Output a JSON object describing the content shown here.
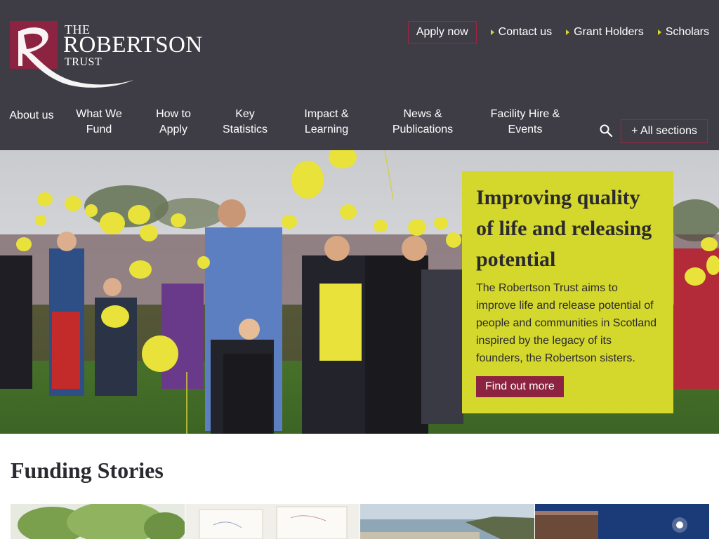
{
  "logo": {
    "line1": "THE",
    "line2": "ROBERTSON",
    "line3": "TRUST",
    "color": "#8c2340"
  },
  "utility_nav": {
    "apply_label": "Apply now",
    "links": [
      {
        "label": "Contact us",
        "icon": "triangle-right-icon"
      },
      {
        "label": "Grant Holders",
        "icon": "triangle-right-icon"
      },
      {
        "label": "Scholars",
        "icon": "triangle-right-icon"
      }
    ]
  },
  "main_nav": {
    "items": [
      {
        "label": "About us"
      },
      {
        "label": "What We Fund"
      },
      {
        "label": "How to Apply"
      },
      {
        "label": "Key Statistics"
      },
      {
        "label": "Impact & Learning"
      },
      {
        "label": "News & Publications"
      },
      {
        "label": "Facility Hire & Events"
      }
    ],
    "search_icon": "search-icon",
    "all_sections_label": "+ All sections"
  },
  "hero": {
    "heading": "Improving quality of life and releasing potential",
    "text": "The Robertson Trust aims to improve life and release potential of people and communities in Scotland inspired by the legacy of its founders, the Robertson sisters.",
    "cta_label": "Find out more"
  },
  "funding_stories": {
    "title": "Funding Stories"
  },
  "colors": {
    "header_bg": "#3e3d45",
    "accent_yellow": "#d4d72c",
    "brand_red": "#8c2340"
  }
}
